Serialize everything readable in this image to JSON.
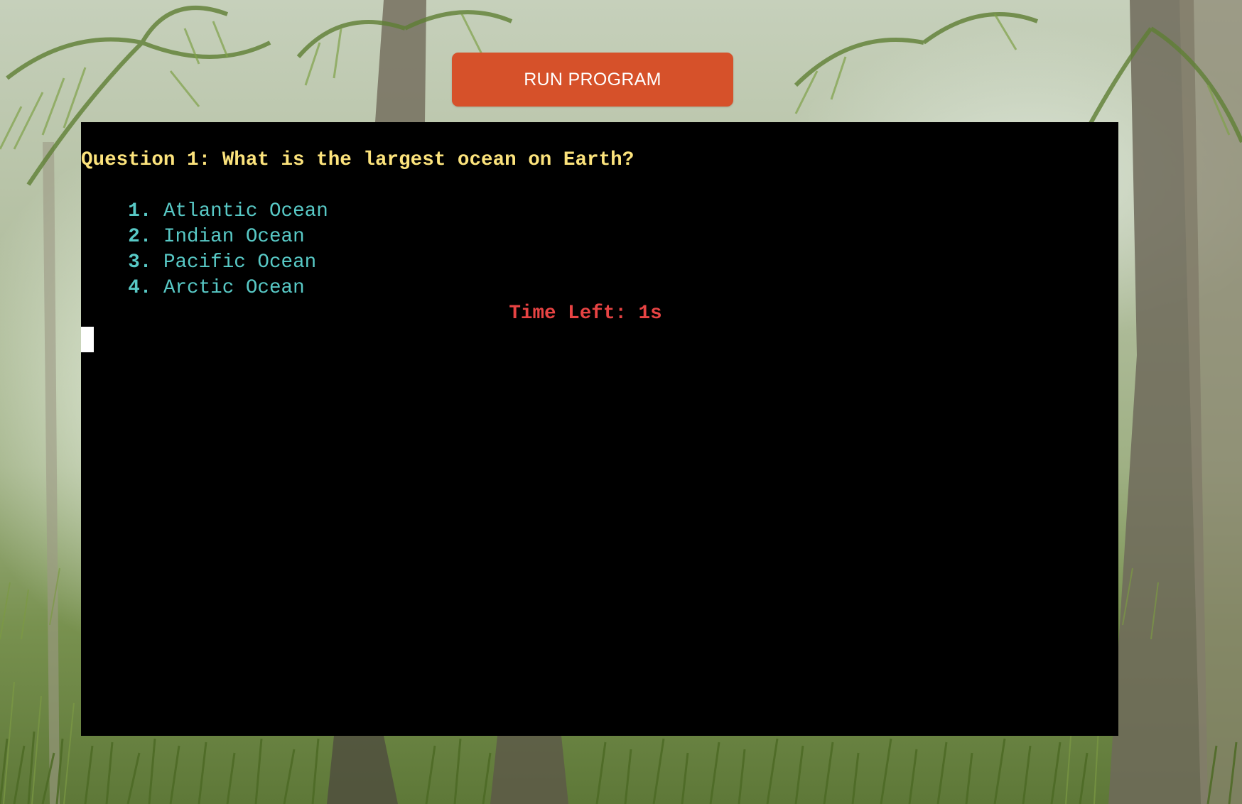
{
  "toolbar": {
    "run_label": "RUN PROGRAM",
    "run_color": "#d6512a"
  },
  "terminal": {
    "background": "#000000",
    "question": "Question 1: What is the largest ocean on Earth?",
    "options": [
      {
        "number": "1.",
        "text": "Atlantic Ocean"
      },
      {
        "number": "2.",
        "text": "Indian Ocean"
      },
      {
        "number": "3.",
        "text": "Pacific Ocean"
      },
      {
        "number": "4.",
        "text": "Arctic Ocean"
      }
    ],
    "timer": "Time Left: 1s",
    "colors": {
      "question": "#fce37c",
      "options": "#58c9c6",
      "timer": "#e74343",
      "cursor": "#ffffff"
    }
  },
  "background": {
    "description_icon": "jungle-palm-background"
  }
}
